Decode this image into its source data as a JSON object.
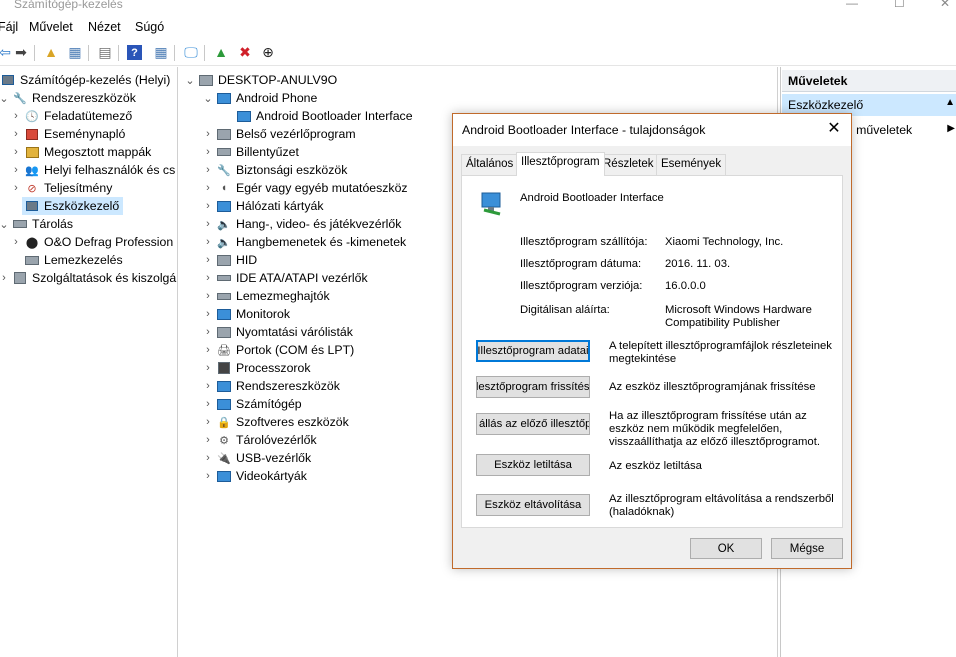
{
  "window": {
    "title": "Számítógép-kezelés"
  },
  "menu": [
    "Fájl",
    "Művelet",
    "Nézet",
    "Súgó"
  ],
  "left_tree": [
    {
      "label": "Számítógép-kezelés (Helyi)",
      "indent": 0,
      "expander": "",
      "icon": "computer-management-icon"
    },
    {
      "label": "Rendszereszközök",
      "indent": 1,
      "expander": "⌄",
      "icon": "system-tools-icon"
    },
    {
      "label": "Feladatütemező",
      "indent": 2,
      "expander": "›",
      "icon": "task-scheduler-icon"
    },
    {
      "label": "Eseménynapló",
      "indent": 2,
      "expander": "›",
      "icon": "event-viewer-icon"
    },
    {
      "label": "Megosztott mappák",
      "indent": 2,
      "expander": "›",
      "icon": "shared-folders-icon"
    },
    {
      "label": "Helyi felhasználók és cs",
      "indent": 2,
      "expander": "›",
      "icon": "local-users-icon"
    },
    {
      "label": "Teljesítmény",
      "indent": 2,
      "expander": "›",
      "icon": "performance-icon"
    },
    {
      "label": "Eszközkezelő",
      "indent": 2,
      "expander": "",
      "icon": "device-manager-icon",
      "selected": true
    },
    {
      "label": "Tárolás",
      "indent": 1,
      "expander": "⌄",
      "icon": "storage-icon"
    },
    {
      "label": "O&O Defrag Profession",
      "indent": 2,
      "expander": "›",
      "icon": "defrag-icon"
    },
    {
      "label": "Lemezkezelés",
      "indent": 2,
      "expander": "",
      "icon": "disk-management-icon"
    },
    {
      "label": "Szolgáltatások és kiszolgáló",
      "indent": 1,
      "expander": "›",
      "icon": "services-icon"
    }
  ],
  "device_tree": [
    {
      "label": "DESKTOP-ANULV9O",
      "indent": 0,
      "expander": "⌄",
      "icon": "computer-icon"
    },
    {
      "label": "Android Phone",
      "indent": 1,
      "expander": "⌄",
      "icon": "android-phone-icon"
    },
    {
      "label": "Android Bootloader Interface",
      "indent": 2,
      "expander": "",
      "icon": "android-device-icon"
    },
    {
      "label": "Belső vezérlőprogram",
      "indent": 1,
      "expander": "›",
      "icon": "firmware-icon"
    },
    {
      "label": "Billentyűzet",
      "indent": 1,
      "expander": "›",
      "icon": "keyboard-icon"
    },
    {
      "label": "Biztonsági eszközök",
      "indent": 1,
      "expander": "›",
      "icon": "security-devices-icon"
    },
    {
      "label": "Egér vagy egyéb mutatóeszköz",
      "indent": 1,
      "expander": "›",
      "icon": "mouse-icon"
    },
    {
      "label": "Hálózati kártyák",
      "indent": 1,
      "expander": "›",
      "icon": "network-adapter-icon"
    },
    {
      "label": "Hang-, video- és játékvezérlők",
      "indent": 1,
      "expander": "›",
      "icon": "sound-icon"
    },
    {
      "label": "Hangbemenetek és -kimenetek",
      "indent": 1,
      "expander": "›",
      "icon": "audio-io-icon"
    },
    {
      "label": "HID",
      "indent": 1,
      "expander": "›",
      "icon": "hid-icon"
    },
    {
      "label": "IDE ATA/ATAPI vezérlők",
      "indent": 1,
      "expander": "›",
      "icon": "ide-controller-icon"
    },
    {
      "label": "Lemezmeghajtók",
      "indent": 1,
      "expander": "›",
      "icon": "disk-drive-icon"
    },
    {
      "label": "Monitorok",
      "indent": 1,
      "expander": "›",
      "icon": "monitor-icon"
    },
    {
      "label": "Nyomtatási várólisták",
      "indent": 1,
      "expander": "›",
      "icon": "print-queue-icon"
    },
    {
      "label": "Portok (COM és LPT)",
      "indent": 1,
      "expander": "›",
      "icon": "ports-icon"
    },
    {
      "label": "Processzorok",
      "indent": 1,
      "expander": "›",
      "icon": "processor-icon"
    },
    {
      "label": "Rendszereszközök",
      "indent": 1,
      "expander": "›",
      "icon": "system-devices-icon"
    },
    {
      "label": "Számítógép",
      "indent": 1,
      "expander": "›",
      "icon": "computer-icon"
    },
    {
      "label": "Szoftveres eszközök",
      "indent": 1,
      "expander": "›",
      "icon": "software-devices-icon"
    },
    {
      "label": "Tárolóvezérlők",
      "indent": 1,
      "expander": "›",
      "icon": "storage-controller-icon"
    },
    {
      "label": "USB-vezérlők",
      "indent": 1,
      "expander": "›",
      "icon": "usb-icon"
    },
    {
      "label": "Videokártyák",
      "indent": 1,
      "expander": "›",
      "icon": "display-adapter-icon"
    }
  ],
  "actions_pane": {
    "header": "Műveletek",
    "selected": "Eszközkezelő",
    "sub": "i műveletek"
  },
  "dialog": {
    "title": "Android Bootloader Interface - tulajdonságok",
    "tabs": [
      "Általános",
      "Illesztőprogram",
      "Részletek",
      "Események"
    ],
    "active_tab": 1,
    "device_name": "Android Bootloader Interface",
    "props": [
      {
        "label": "Illesztőprogram szállítója:",
        "value": "Xiaomi Technology, Inc."
      },
      {
        "label": "Illesztőprogram dátuma:",
        "value": "2016. 11. 03."
      },
      {
        "label": "Illesztőprogram verziója:",
        "value": "16.0.0.0"
      },
      {
        "label": "Digitálisan aláírta:",
        "value": "Microsoft Windows Hardware Compatibility Publisher"
      }
    ],
    "buttons": [
      {
        "label": "Illesztőprogram adatai",
        "desc": "A telepített illesztőprogramfájlok részleteinek megtekintése",
        "default": true
      },
      {
        "label": "Illesztőprogram frissítése",
        "desc": "Az eszköz illesztőprogramjának frissítése"
      },
      {
        "label": "állás az előző illesztőprog",
        "desc": "Ha az illesztőprogram frissítése után az eszköz nem működik megfelelően, visszaállíthatja az előző illesztőprogramot."
      },
      {
        "label": "Eszköz letiltása",
        "desc": "Az eszköz letiltása"
      },
      {
        "label": "Eszköz eltávolítása",
        "desc": "Az illesztőprogram eltávolítása a rendszerből (haladóknak)"
      }
    ],
    "ok": "OK",
    "cancel": "Mégse"
  }
}
